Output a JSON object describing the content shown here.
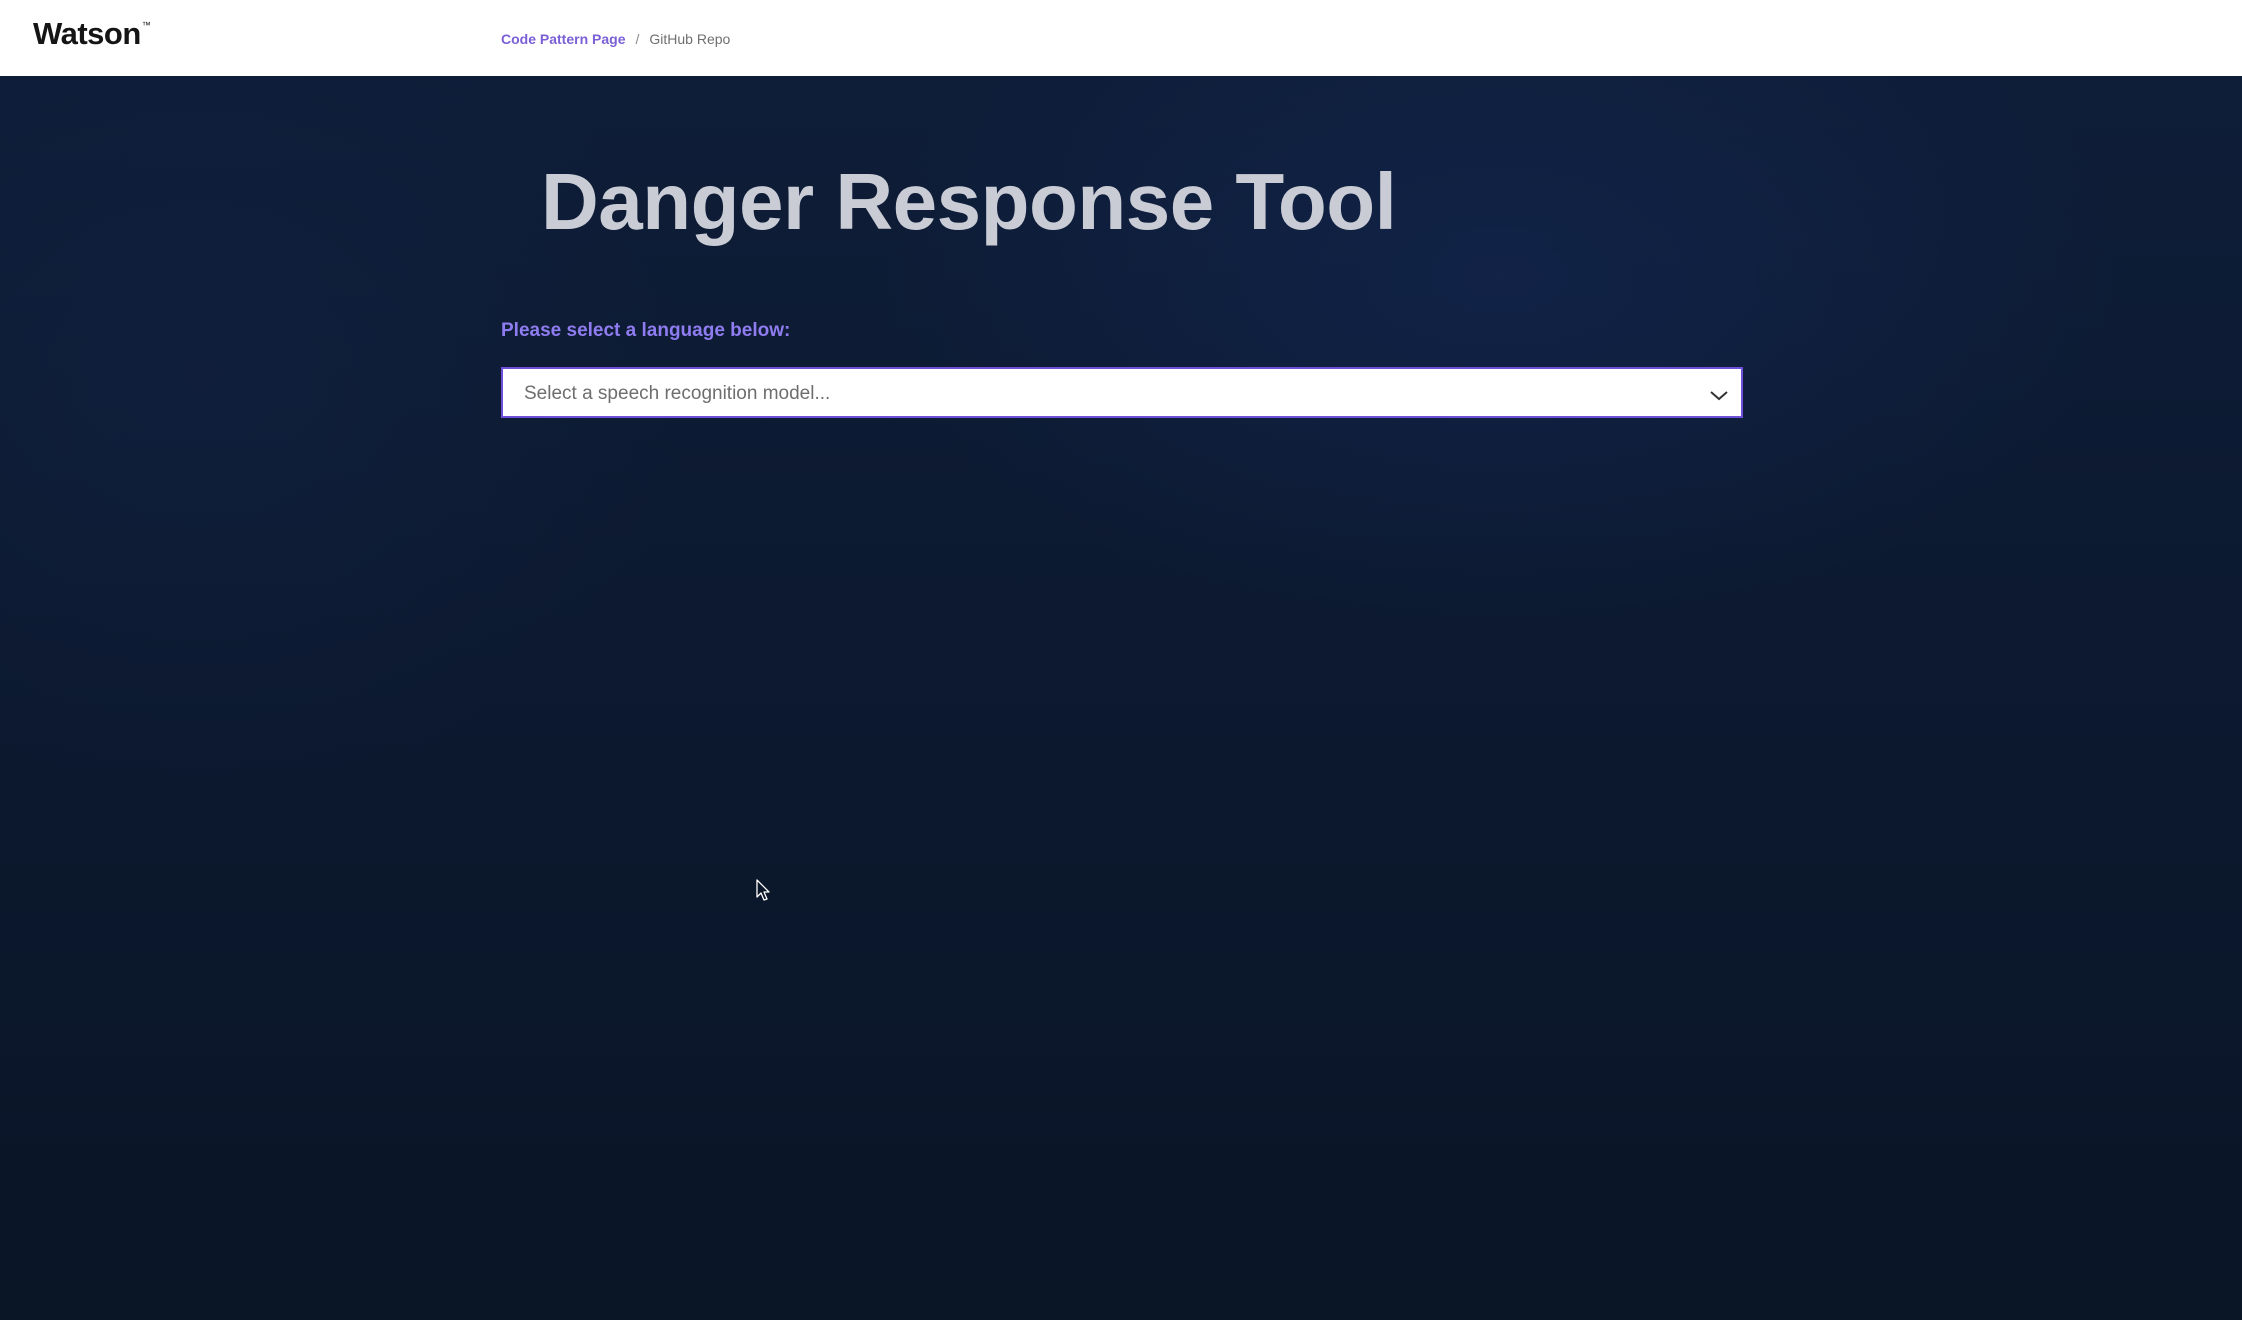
{
  "header": {
    "logo_text": "Watson",
    "logo_trademark": "™",
    "breadcrumb": {
      "link_label": "Code Pattern Page",
      "separator": "/",
      "current_label": "GitHub Repo"
    }
  },
  "main": {
    "title": "Danger Response Tool",
    "prompt_label": "Please select a language below:",
    "model_select": {
      "placeholder": "Select a speech recognition model...",
      "icon": "chevron-down-icon"
    }
  },
  "colors": {
    "accent": "#7b5fd6",
    "prompt": "#8f7cf0",
    "background": "#0b1628",
    "header_background": "#ffffff",
    "title": "#c9ccd4"
  }
}
